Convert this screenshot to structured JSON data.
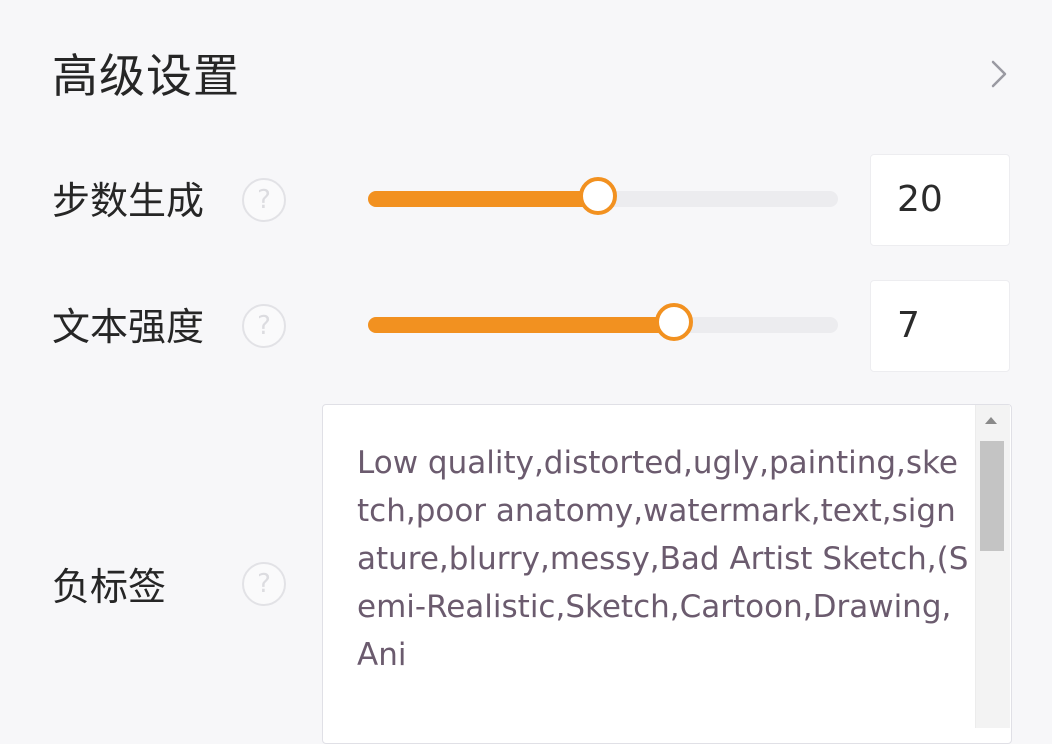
{
  "section": {
    "title": "高级设置",
    "expand_icon": "chevron-right-icon"
  },
  "steps": {
    "label": "步数生成",
    "help_icon": "question-circle-icon",
    "help_glyph": "?",
    "value": "20",
    "slider_fraction": 0.49,
    "accent": "#f29120"
  },
  "text_strength": {
    "label": "文本强度",
    "help_icon": "question-circle-icon",
    "help_glyph": "?",
    "value": "7",
    "slider_fraction": 0.65,
    "accent": "#f29120"
  },
  "negative_tags": {
    "label": "负标签",
    "help_icon": "question-circle-icon",
    "help_glyph": "?",
    "value": "Low quality,distorted,ugly,painting,sketch,poor anatomy,watermark,text,signature,blurry,messy,Bad Artist Sketch,(Semi-Realistic,Sketch,Cartoon,Drawing,Ani"
  }
}
